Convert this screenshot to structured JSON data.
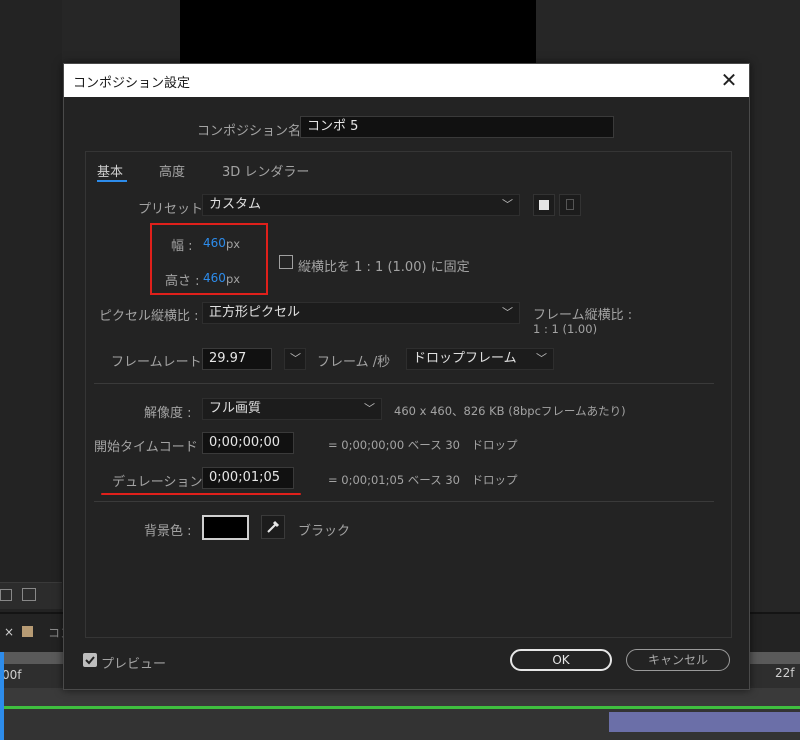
{
  "background": {
    "timeline_start_label": "00f",
    "timeline_end_label": "22f",
    "tab_close": "×",
    "tab_label_partial": "コン"
  },
  "dialog": {
    "title": "コンポジション設定",
    "close_glyph": "✕",
    "comp_name_label": "コンポジション名 :",
    "comp_name_value": "コンポ 5",
    "tabs": [
      "基本",
      "高度",
      "3D レンダラー"
    ],
    "preset_label": "プリセット :",
    "preset_value": "カスタム",
    "width_label": "幅 :",
    "width_value": "460",
    "width_unit": "px",
    "height_label": "高さ :",
    "height_value": "460",
    "height_unit": "px",
    "lock_aspect_label": "縦横比を 1 : 1 (1.00) に固定",
    "pixel_aspect_label": "ピクセル縦横比 :",
    "pixel_aspect_value": "正方形ピクセル",
    "frame_aspect_label": "フレーム縦横比 :",
    "frame_aspect_value": "1 : 1 (1.00)",
    "frame_rate_label": "フレームレート :",
    "frame_rate_value": "29.97",
    "frame_rate_unit": "フレーム /秒",
    "drop_frame_value": "ドロップフレーム",
    "resolution_label": "解像度 :",
    "resolution_value": "フル画質",
    "resolution_info": "460 x 460、826 KB (8bpcフレームあたり)",
    "start_timecode_label": "開始タイムコード :",
    "start_timecode_value": "0;00;00;00",
    "start_timecode_info": "= 0;00;00;00 ベース 30　ドロップ",
    "duration_label": "デュレーション :",
    "duration_value": "0;00;01;05",
    "duration_info": "= 0;00;01;05 ベース 30　ドロップ",
    "bg_color_label": "背景色 :",
    "bg_color_name": "ブラック",
    "preview_label": "プレビュー",
    "ok_label": "OK",
    "cancel_label": "キャンセル"
  },
  "colors": {
    "accent_blue": "#2d8ceb",
    "annotation_red": "#e0201b",
    "timeline_green": "#3fbf3f"
  }
}
